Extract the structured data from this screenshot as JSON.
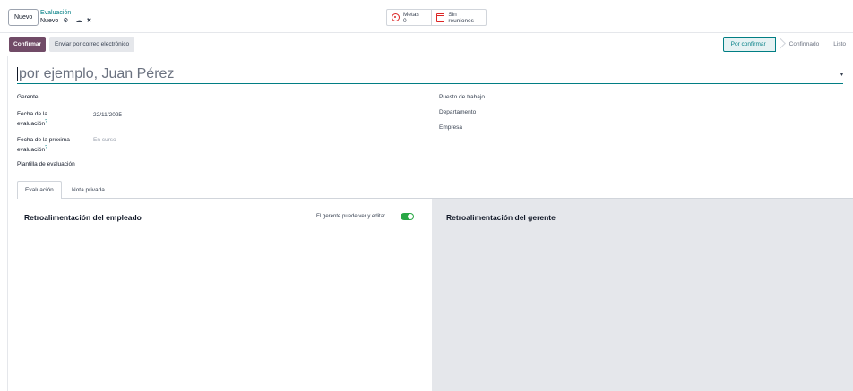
{
  "control_panel": {
    "new_button": "Nuevo",
    "breadcrumb_parent": "Evaluación",
    "breadcrumb_current": "Nuevo",
    "gear_icon": "⚙",
    "save_icon": "☁",
    "discard_icon": "✖"
  },
  "smart_buttons": {
    "goals_label": "Metas",
    "goals_count": "0",
    "meetings_label": "Sin reuniones"
  },
  "status_bar": {
    "confirm_button": "Confirmar",
    "email_button": "Enviar por correo electrónico",
    "stages": [
      "Por confirmar",
      "Confirmado",
      "Listo"
    ],
    "active_stage": "Por confirmar"
  },
  "form": {
    "name_placeholder": "por ejemplo, Juan Pérez",
    "dropdown_icon": "▾",
    "manager_label": "Gerente",
    "eval_date_label_1": "Fecha de la",
    "eval_date_label_2": "evaluación",
    "eval_date_value": "22/11/2025",
    "next_eval_label_1": "Fecha de la próxima",
    "next_eval_label_2": "evaluación",
    "next_eval_value": "En curso",
    "template_label": "Plantilla de evaluación",
    "job_label": "Puesto de trabajo",
    "department_label": "Departamento",
    "company_label": "Empresa",
    "help_mark": "?"
  },
  "tabs": [
    "Evaluación",
    "Nota privada"
  ],
  "panels": {
    "employee_title": "Retroalimentación del empleado",
    "manager_can_edit_label": "El gerente puede ver y editar",
    "manager_can_edit_enabled": true,
    "manager_title": "Retroalimentación del gerente"
  },
  "colors": {
    "primary": "#714b67",
    "accent": "#017e84",
    "toggle_on": "#28a745",
    "manager_panel_bg": "#e5e7eb"
  }
}
